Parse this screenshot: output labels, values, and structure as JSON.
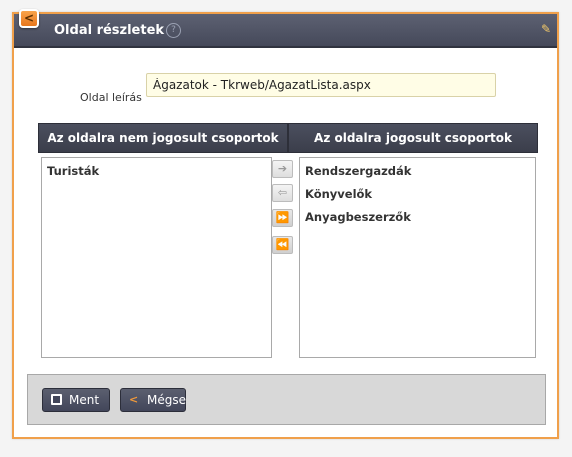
{
  "back_button": {
    "label": "<"
  },
  "dialog": {
    "title": "Oldal részletek",
    "help_symbol": "?",
    "edit_symbol": "✎"
  },
  "form": {
    "description_label": "Oldal leírás",
    "description_value": "Ágazatok - Tkrweb/AgazatLista.aspx"
  },
  "lists": {
    "left_header": "Az oldalra nem jogosult csoportok",
    "right_header": "Az oldalra jogosult csoportok",
    "left_items": [
      "Turisták"
    ],
    "right_items": [
      "Rendszergazdák",
      "Könyvelők",
      "Anyagbeszerzők"
    ]
  },
  "move_buttons": {
    "move_right": "➔",
    "move_left": "⇦",
    "move_all_right": "⏩",
    "move_all_left": "⏪"
  },
  "footer": {
    "save_label": "Ment",
    "cancel_label": "Mégse",
    "cancel_icon": "<"
  },
  "colors": {
    "accent": "#f0a04b",
    "titlebar": "#45495a"
  }
}
